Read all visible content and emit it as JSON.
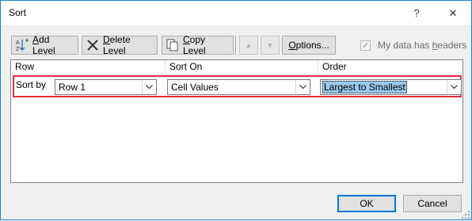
{
  "window": {
    "title": "Sort",
    "help_glyph": "?",
    "close_glyph": "✕"
  },
  "toolbar": {
    "add_level": {
      "accel": "A",
      "rest": "dd Level"
    },
    "delete_level": {
      "accel": "D",
      "rest": "elete Level"
    },
    "copy_level": {
      "accel": "C",
      "rest": "opy Level"
    },
    "options": {
      "accel": "O",
      "rest": "ptions..."
    },
    "headers_checkbox": {
      "label_pre": "My data has ",
      "label_accel": "h",
      "label_post": "eaders",
      "checked": true
    }
  },
  "grid": {
    "headers": [
      "Row",
      "Sort On",
      "Order"
    ],
    "row": {
      "label": "Sort by",
      "sort_by_value": "Row 1",
      "sort_on_value": "Cell Values",
      "order_value": "Largest to Smallest"
    }
  },
  "footer": {
    "ok": "OK",
    "cancel": "Cancel"
  },
  "colors": {
    "highlight_border": "#e5303b",
    "selection": "#99c9ef",
    "accent": "#0078d7"
  }
}
